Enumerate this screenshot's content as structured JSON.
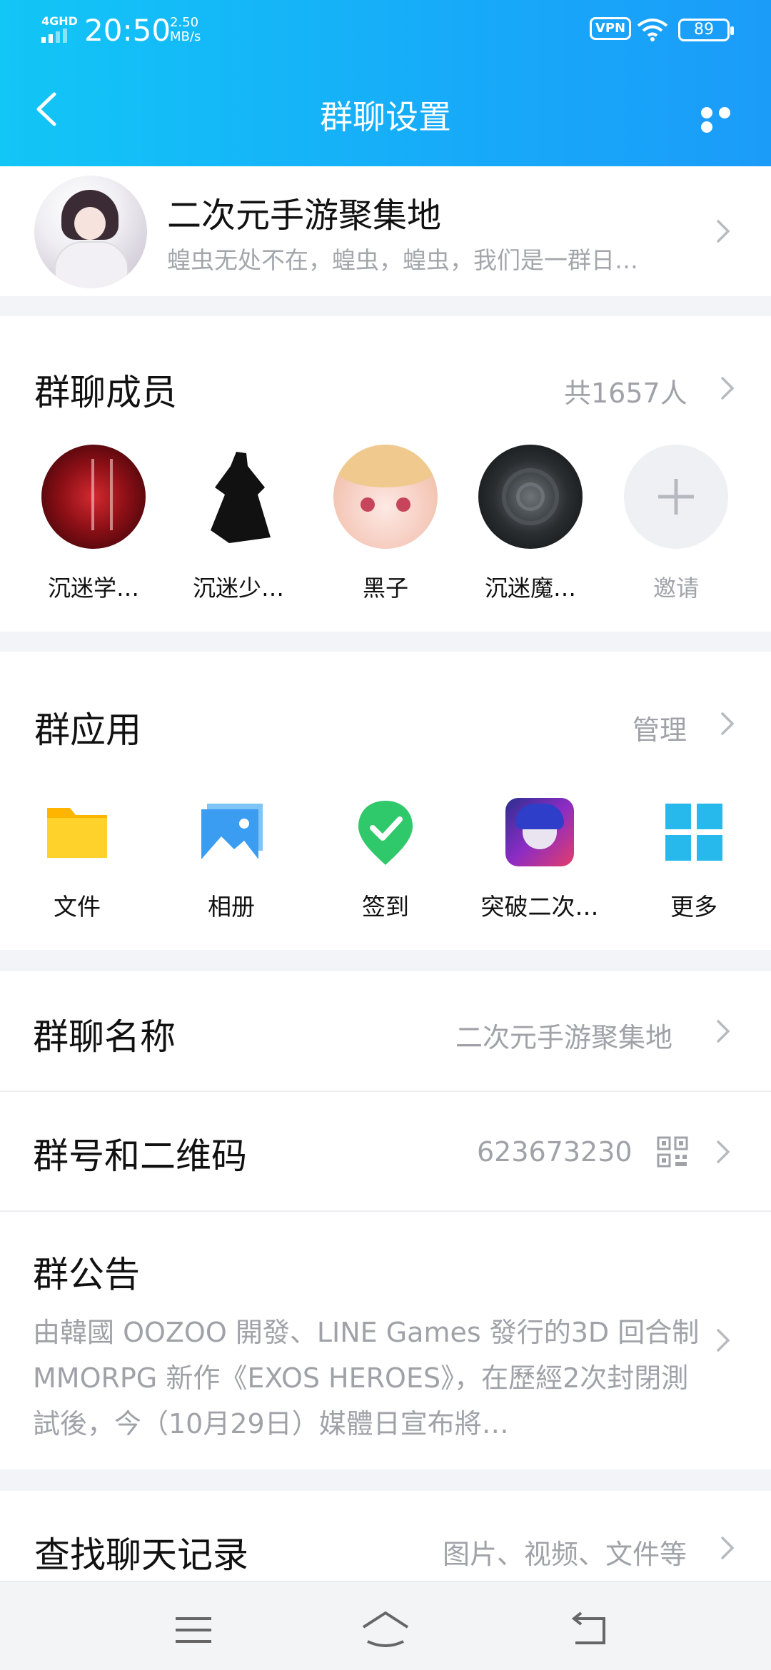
{
  "status_bar": {
    "network": "4GHD",
    "time": "20:50",
    "speed_value": "2.50",
    "speed_unit": "MB/s",
    "vpn": "VPN",
    "battery": "89"
  },
  "header": {
    "title": "群聊设置",
    "back_icon": "chevron-left-icon",
    "more_icon": "more-dots-icon"
  },
  "group": {
    "name": "二次元手游聚集地",
    "description": "蝗虫无处不在，蝗虫，蝗虫，我们是一群日…"
  },
  "members": {
    "title": "群聊成员",
    "count": "共1657人",
    "list": [
      {
        "name": "沉迷学…"
      },
      {
        "name": "沉迷少…"
      },
      {
        "name": "黑子"
      },
      {
        "name": "沉迷魔…"
      }
    ],
    "invite_label": "邀请"
  },
  "apps": {
    "title": "群应用",
    "manage": "管理",
    "list": [
      {
        "name": "文件",
        "icon": "folder-icon"
      },
      {
        "name": "相册",
        "icon": "photo-album-icon"
      },
      {
        "name": "签到",
        "icon": "check-in-icon"
      },
      {
        "name": "突破二次…",
        "icon": "game-app-icon"
      },
      {
        "name": "更多",
        "icon": "grid-more-icon"
      }
    ]
  },
  "settings": {
    "group_name_label": "群聊名称",
    "group_name_value": "二次元手游聚集地",
    "group_id_label": "群号和二维码",
    "group_id_value": "623673230",
    "notice_label": "群公告",
    "notice_text": "由韓國 OOZOO 開發、LINE Games 發行的3D 回合制 MMORPG 新作《EXOS HEROES》，在歷經2次封閉測試後，今（10月29日）媒體日宣布將…",
    "search_label": "查找聊天记录",
    "search_value": "图片、视频、文件等"
  },
  "colors": {
    "header_start": "#12c6f6",
    "header_end": "#1b9cf9",
    "secondary_text": "#a0a2a8",
    "check_in_green": "#2fc86a",
    "folder_yellow": "#ffc81e"
  }
}
